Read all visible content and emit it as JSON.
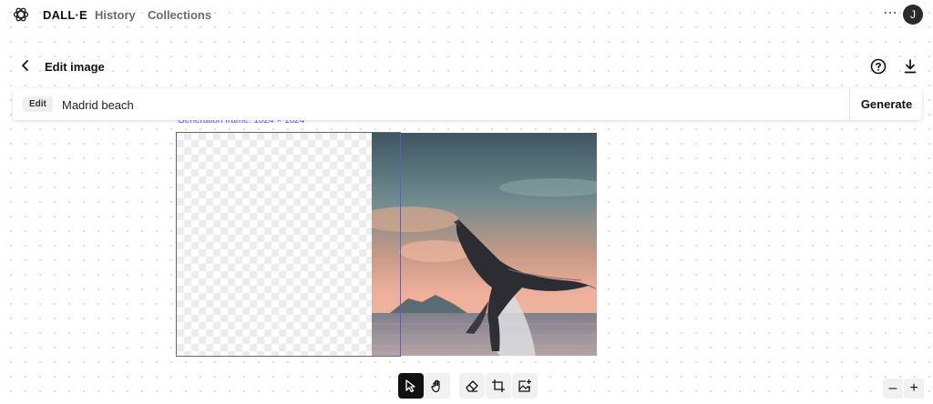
{
  "app": {
    "brand": "DALL·E",
    "nav": [
      "History",
      "Collections"
    ],
    "avatar_initial": "J",
    "more_icon": "ellipsis-icon"
  },
  "page": {
    "title": "Edit image",
    "back_icon": "chevron-left-icon",
    "help_icon": "help-circle-icon",
    "download_icon": "download-icon"
  },
  "prompt": {
    "mode_tag": "Edit",
    "value": "Madrid beach",
    "generate_label": "Generate"
  },
  "canvas": {
    "frame_label": "Generation frame: 1024 × 1024",
    "accent_color": "#5a5ae0"
  },
  "toolbar": {
    "tools": [
      {
        "name": "select",
        "icon": "cursor-icon",
        "active": true
      },
      {
        "name": "pan",
        "icon": "hand-icon",
        "active": false
      },
      {
        "name": "eraser",
        "icon": "eraser-icon",
        "active": false
      },
      {
        "name": "add-frame",
        "icon": "frame-icon",
        "active": false
      },
      {
        "name": "upload-image",
        "icon": "image-add-icon",
        "active": false
      }
    ]
  },
  "zoom": {
    "out_label": "–",
    "in_label": "+"
  }
}
